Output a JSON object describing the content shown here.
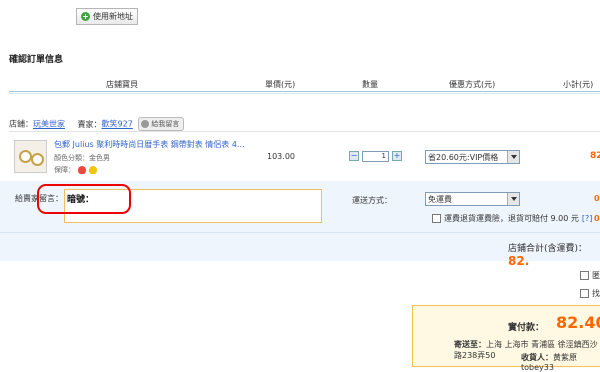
{
  "add_address_label": "使用新地址",
  "section_title": "確認訂單信息",
  "headers": {
    "shop_item": "店鋪寶貝",
    "unit_price": "單價(元)",
    "quantity": "數量",
    "discount": "優惠方式(元)",
    "subtotal": "小計(元)"
  },
  "shop": {
    "label": "店鋪：",
    "name": "玩美世家",
    "seller_label": "賣家：",
    "seller": "歡笑927",
    "message_btn": "給我留言"
  },
  "product": {
    "name": "包郵 Julius 聚利時時尚日暦手表 鋼帶對表 情侶表 4...",
    "color_label": "顏色分類：金色男",
    "protection_label": "保障：",
    "price": "103.00",
    "qty": "1",
    "discount_option": "省20.60元:VIP價格",
    "subtotal_partial": "82"
  },
  "message": {
    "label": "給賣家留言：",
    "value": "暗號："
  },
  "shipping": {
    "label": "運送方式：",
    "option": "免運費",
    "partial_value": "0"
  },
  "insurance": {
    "text": "運費退貨運費險，退貨可賠付 9.00 元",
    "help": "[?]",
    "partial_value": "0"
  },
  "shop_total": {
    "label": "店鋪合計(含運費)：",
    "value": "82."
  },
  "payment": {
    "real_label": "實付款：",
    "real_value": "82.40",
    "ship_to_label": "寄送至：",
    "ship_to": "上海 上海市 青浦區 徐涇鎮西沙路238弄50",
    "receiver_label": "收貨人：",
    "receiver": "黄紫原tobey33"
  },
  "side_options": [
    "匿",
    "找"
  ],
  "colors": {
    "accent": "#ff6600",
    "link": "#3366cc",
    "header_line": "#9ec6e6"
  }
}
